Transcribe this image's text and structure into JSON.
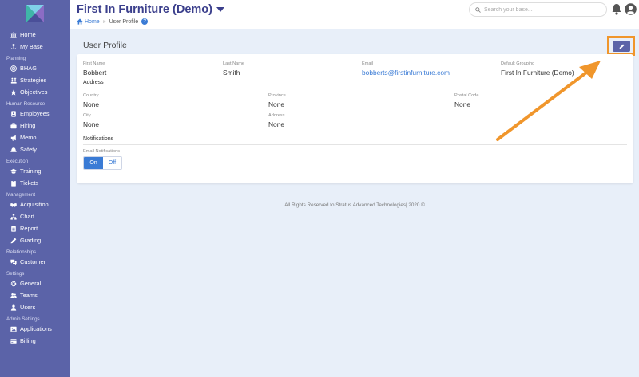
{
  "app": {
    "title": "First In Furniture (Demo)"
  },
  "breadcrumb": {
    "home": "Home",
    "separator": "»",
    "current": "User Profile",
    "help": "?"
  },
  "search": {
    "placeholder": "Search your base..."
  },
  "sidebar": {
    "groups": [
      {
        "section": "",
        "items": [
          {
            "label": "Home",
            "icon": "bank-icon"
          },
          {
            "label": "My Base",
            "icon": "anchor-icon"
          }
        ]
      },
      {
        "section": "Planning",
        "items": [
          {
            "label": "BHAG",
            "icon": "bullseye-icon"
          },
          {
            "label": "Strategies",
            "icon": "chess-icon"
          },
          {
            "label": "Objectives",
            "icon": "star-icon"
          }
        ]
      },
      {
        "section": "Human Resource",
        "items": [
          {
            "label": "Employees",
            "icon": "id-card-icon"
          },
          {
            "label": "Hiring",
            "icon": "briefcase-icon"
          },
          {
            "label": "Memo",
            "icon": "megaphone-icon"
          },
          {
            "label": "Safety",
            "icon": "hardhat-icon"
          }
        ]
      },
      {
        "section": "Execution",
        "items": [
          {
            "label": "Training",
            "icon": "graduation-cap-icon"
          },
          {
            "label": "Tickets",
            "icon": "clipboard-icon"
          }
        ]
      },
      {
        "section": "Management",
        "items": [
          {
            "label": "Acquisition",
            "icon": "handshake-icon"
          },
          {
            "label": "Chart",
            "icon": "org-chart-icon"
          },
          {
            "label": "Report",
            "icon": "clipboard-list-icon"
          },
          {
            "label": "Grading",
            "icon": "pencil-icon"
          }
        ]
      },
      {
        "section": "Relationships",
        "items": [
          {
            "label": "Customer",
            "icon": "comments-icon"
          }
        ]
      },
      {
        "section": "Settings",
        "items": [
          {
            "label": "General",
            "icon": "gear-icon"
          },
          {
            "label": "Teams",
            "icon": "users-icon"
          },
          {
            "label": "Users",
            "icon": "user-icon"
          }
        ]
      },
      {
        "section": "Admin Settings",
        "items": [
          {
            "label": "Applications",
            "icon": "image-icon"
          },
          {
            "label": "Billing",
            "icon": "credit-card-icon"
          }
        ]
      }
    ]
  },
  "profile": {
    "title": "User Profile",
    "first_name": {
      "label": "First Name",
      "value": "Bobbert"
    },
    "last_name": {
      "label": "Last Name",
      "value": "Smith"
    },
    "email": {
      "label": "Email",
      "value": "bobberts@firstinfurniture.com"
    },
    "default_grouping": {
      "label": "Default Grouping",
      "value": "First In Furniture (Demo)"
    },
    "address_section": "Address",
    "country": {
      "label": "Country",
      "value": "None"
    },
    "province": {
      "label": "Province",
      "value": "None"
    },
    "postal_code": {
      "label": "Postal Code",
      "value": "None"
    },
    "city": {
      "label": "City",
      "value": "None"
    },
    "address": {
      "label": "Address",
      "value": "None"
    },
    "notifications_section": "Notifications",
    "email_notifications": {
      "label": "Email Notifications",
      "on": "On",
      "off": "Off",
      "selected": "On"
    }
  },
  "footer": {
    "text": "All Rights Reserved to Stratus Advanced Technologies| 2020 ©"
  },
  "colors": {
    "sidebar": "#5b63a8",
    "accent": "#3a7bd5",
    "title": "#3b3f8c",
    "highlight": "#f0962c",
    "background": "#e8eff9"
  }
}
